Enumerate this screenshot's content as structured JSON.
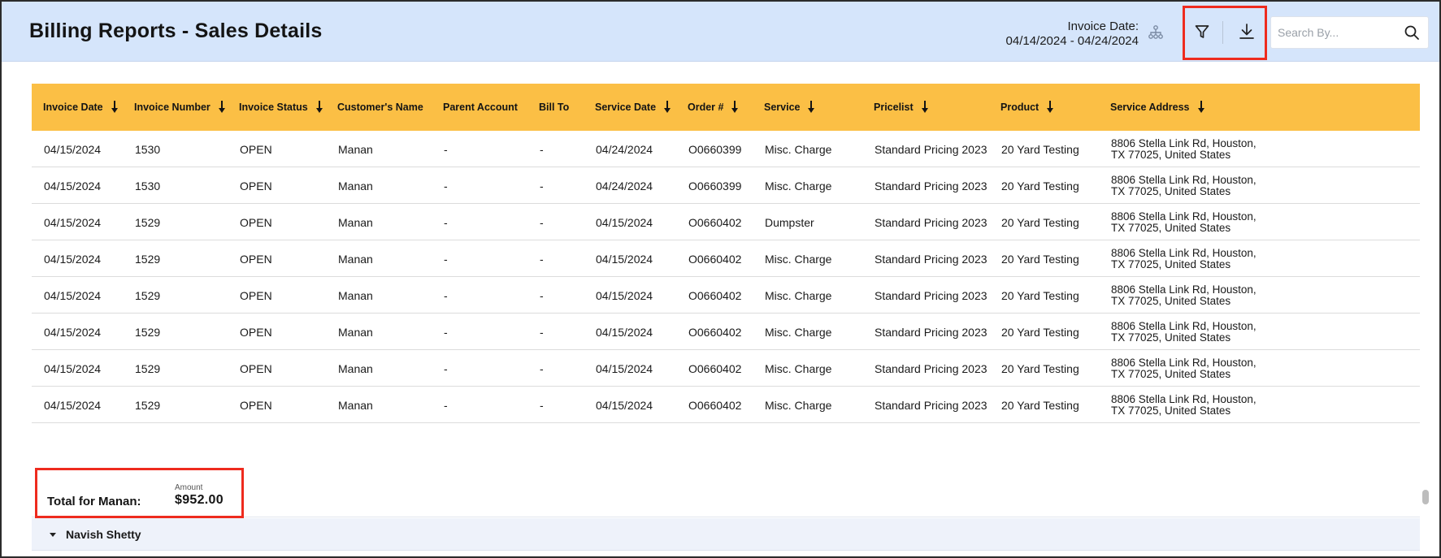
{
  "header": {
    "title": "Billing Reports - Sales Details",
    "date_label": "Invoice Date:",
    "date_range": "04/14/2024 - 04/24/2024",
    "icons": {
      "hierarchy": "hierarchy-icon",
      "filter": "filter-icon",
      "download": "download-icon",
      "search": "search-icon"
    }
  },
  "search": {
    "placeholder": "Search By...",
    "value": ""
  },
  "table": {
    "columns": [
      {
        "label": "Invoice Date",
        "sortable": true
      },
      {
        "label": "Invoice Number",
        "sortable": true
      },
      {
        "label": "Invoice Status",
        "sortable": true
      },
      {
        "label": "Customer's Name",
        "sortable": false
      },
      {
        "label": "Parent Account",
        "sortable": false
      },
      {
        "label": "Bill To",
        "sortable": false
      },
      {
        "label": "Service Date",
        "sortable": true
      },
      {
        "label": "Order #",
        "sortable": true
      },
      {
        "label": "Service",
        "sortable": true
      },
      {
        "label": "Pricelist",
        "sortable": true
      },
      {
        "label": "Product",
        "sortable": true
      },
      {
        "label": "Service Address",
        "sortable": true
      }
    ],
    "rows": [
      [
        "04/15/2024",
        "1530",
        "OPEN",
        "Manan",
        "-",
        "-",
        "04/24/2024",
        "O0660399",
        "Misc. Charge",
        "Standard Pricing 2023",
        "20 Yard Testing",
        "8806 Stella Link Rd, Houston, TX 77025, United States"
      ],
      [
        "04/15/2024",
        "1530",
        "OPEN",
        "Manan",
        "-",
        "-",
        "04/24/2024",
        "O0660399",
        "Misc. Charge",
        "Standard Pricing 2023",
        "20 Yard Testing",
        "8806 Stella Link Rd, Houston, TX 77025, United States"
      ],
      [
        "04/15/2024",
        "1529",
        "OPEN",
        "Manan",
        "-",
        "-",
        "04/15/2024",
        "O0660402",
        "Dumpster",
        "Standard Pricing 2023",
        "20 Yard Testing",
        "8806 Stella Link Rd, Houston, TX 77025, United States"
      ],
      [
        "04/15/2024",
        "1529",
        "OPEN",
        "Manan",
        "-",
        "-",
        "04/15/2024",
        "O0660402",
        "Misc. Charge",
        "Standard Pricing 2023",
        "20 Yard Testing",
        "8806 Stella Link Rd, Houston, TX 77025, United States"
      ],
      [
        "04/15/2024",
        "1529",
        "OPEN",
        "Manan",
        "-",
        "-",
        "04/15/2024",
        "O0660402",
        "Misc. Charge",
        "Standard Pricing 2023",
        "20 Yard Testing",
        "8806 Stella Link Rd, Houston, TX 77025, United States"
      ],
      [
        "04/15/2024",
        "1529",
        "OPEN",
        "Manan",
        "-",
        "-",
        "04/15/2024",
        "O0660402",
        "Misc. Charge",
        "Standard Pricing 2023",
        "20 Yard Testing",
        "8806 Stella Link Rd, Houston, TX 77025, United States"
      ],
      [
        "04/15/2024",
        "1529",
        "OPEN",
        "Manan",
        "-",
        "-",
        "04/15/2024",
        "O0660402",
        "Misc. Charge",
        "Standard Pricing 2023",
        "20 Yard Testing",
        "8806 Stella Link Rd, Houston, TX 77025, United States"
      ],
      [
        "04/15/2024",
        "1529",
        "OPEN",
        "Manan",
        "-",
        "-",
        "04/15/2024",
        "O0660402",
        "Misc. Charge",
        "Standard Pricing 2023",
        "20 Yard Testing",
        "8806 Stella Link Rd, Houston, TX 77025, United States"
      ]
    ]
  },
  "total": {
    "label": "Total for Manan:",
    "amount_caption": "Amount",
    "amount": "$952.00"
  },
  "next_group": {
    "name": "Navish Shetty"
  },
  "colors": {
    "header_bg": "#d5e5fb",
    "table_header_bg": "#fbbf45",
    "highlight": "#ee2b1e",
    "group_bg": "#eef2fa"
  }
}
